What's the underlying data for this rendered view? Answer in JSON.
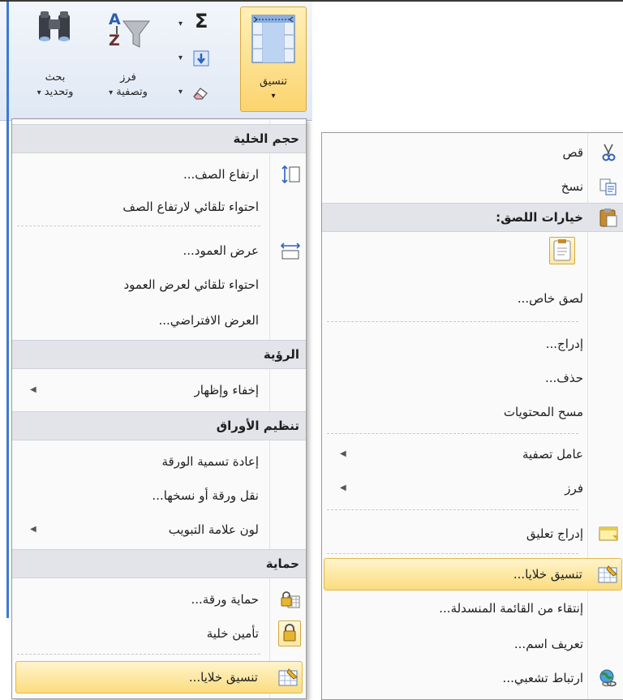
{
  "ribbon": {
    "format_label": "تنسيق",
    "find_label_1": "بحث",
    "find_label_2": "وتحديد",
    "sort_label_1": "فرز",
    "sort_label_2": "وتصفية"
  },
  "left_menu": {
    "cell_size_header": "حجم الخلية",
    "row_height": "ارتفاع الصف...",
    "autofit_row": "احتواء تلقائي لارتفاع الصف",
    "col_width": "عرض العمود...",
    "autofit_col": "احتواء تلقائي لعرض العمود",
    "default_width": "العرض الافتراضي...",
    "visibility_header": "الرؤية",
    "hide_unhide": "إخفاء وإظهار",
    "organize_header": "تنظيم الأوراق",
    "rename_sheet": "إعادة تسمية الورقة",
    "move_copy": "نقل ورقة أو نسخها...",
    "tab_color": "لون علامة التبويب",
    "protection_header": "حماية",
    "protect_sheet": "حماية ورقة...",
    "lock_cell": "تأمين خلية",
    "format_cells": "تنسيق خلايا..."
  },
  "right_menu": {
    "cut": "قص",
    "copy": "نسخ",
    "paste_options": "خيارات اللصق:",
    "paste_special": "لصق خاص...",
    "insert": "إدراج...",
    "delete": "حذف...",
    "clear_contents": "مسح المحتويات",
    "filter": "عامل تصفية",
    "sort": "فرز",
    "insert_comment": "إدراج تعليق",
    "format_cells": "تنسيق خلايا...",
    "pick_dropdown": "إنتقاء من القائمة المنسدلة...",
    "define_name": "تعريف اسم...",
    "hyperlink": "ارتباط تشعبي..."
  },
  "colors": {
    "highlight": "#fbdc7e",
    "header_bg": "#e2e4e9",
    "accent_blue": "#3b7ad6"
  },
  "icons": {
    "find": "binoculars-icon",
    "sort": "sort-filter-icon",
    "sum": "sigma-icon",
    "fill": "fill-down-icon",
    "clear": "eraser-icon",
    "format": "format-grid-icon"
  }
}
